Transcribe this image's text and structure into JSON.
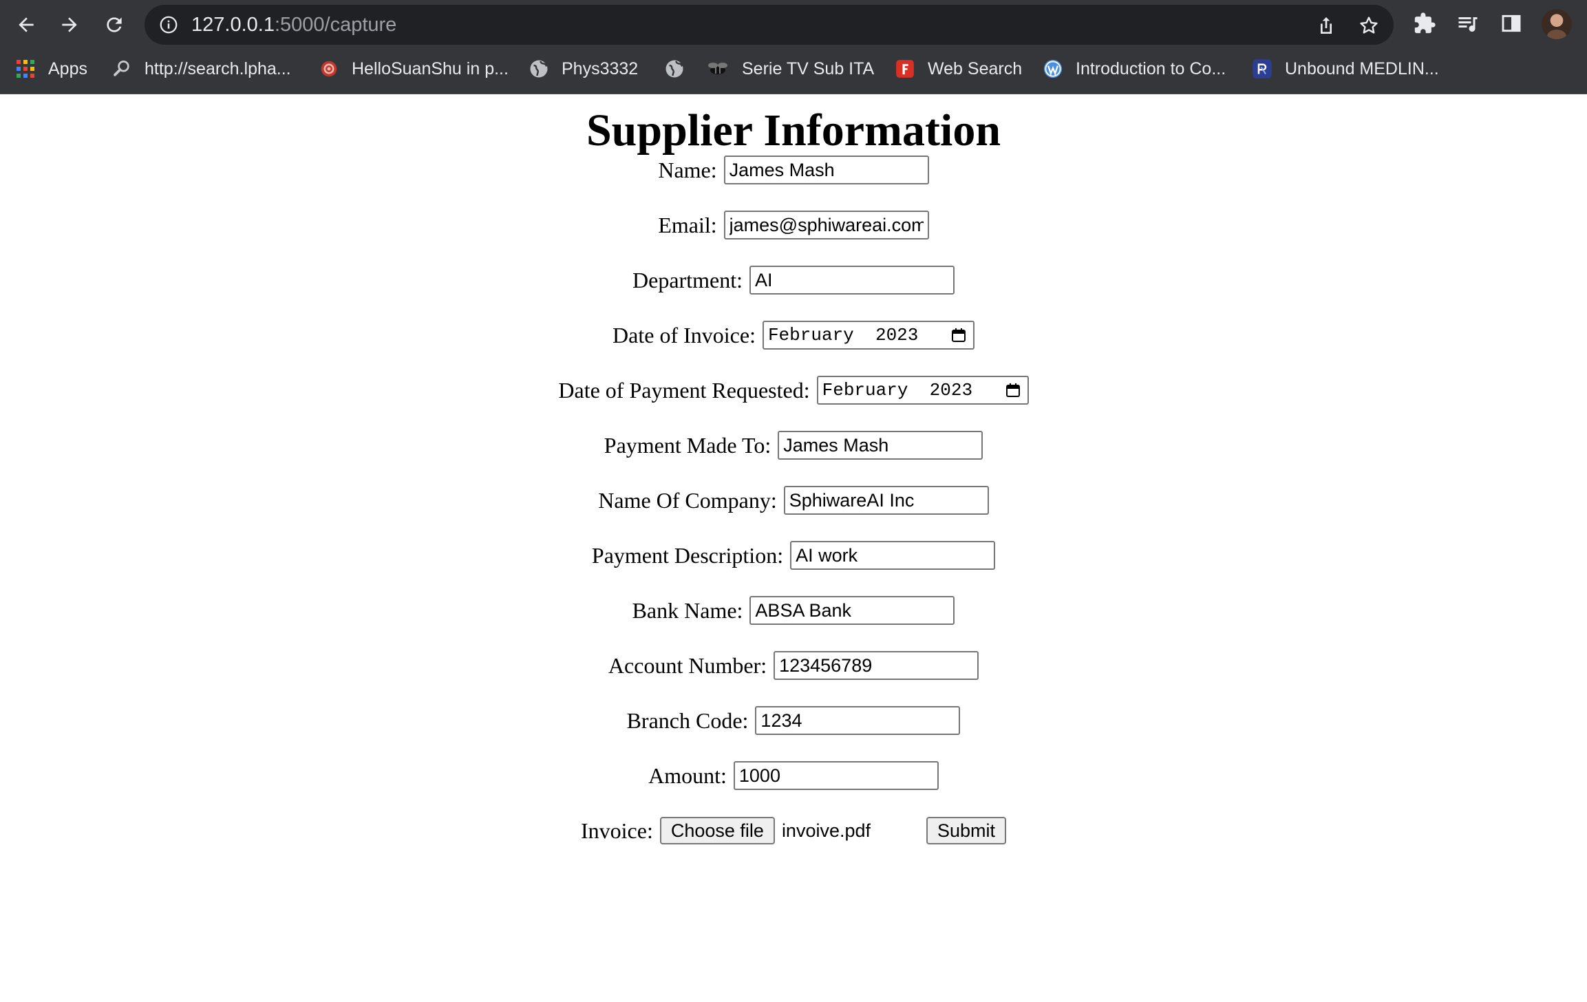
{
  "browser": {
    "url_host": "127.0.0.1",
    "url_path": ":5000/capture",
    "bookmarks": [
      {
        "label": "Apps",
        "icon": "apps-grid-icon"
      },
      {
        "label": "http://search.lpha...",
        "icon": "search-icon"
      },
      {
        "label": "HelloSuanShu in p...",
        "icon": "suanshu-logo-icon"
      },
      {
        "label": "Phys3332",
        "icon": "globe-icon"
      },
      {
        "label": "",
        "icon": "globe-icon"
      },
      {
        "label": "Serie TV Sub ITA",
        "icon": "bee-icon"
      },
      {
        "label": "Web Search",
        "icon": "f-logo-icon"
      },
      {
        "label": "Introduction to Co...",
        "icon": "wordpress-icon"
      },
      {
        "label": "Unbound MEDLIN...",
        "icon": "pubmed-icon"
      }
    ]
  },
  "form": {
    "title": "Supplier Information",
    "name": {
      "label": "Name:",
      "value": "James Mash"
    },
    "email": {
      "label": "Email:",
      "value": "james@sphiwareai.com"
    },
    "department": {
      "label": "Department:",
      "value": "AI"
    },
    "invoice_date": {
      "label": "Date of Invoice:",
      "value": "February  2023"
    },
    "payment_date": {
      "label": "Date of Payment Requested:",
      "value": "February  2023"
    },
    "payment_to": {
      "label": "Payment Made To:",
      "value": "James Mash"
    },
    "company": {
      "label": "Name Of Company:",
      "value": "SphiwareAI Inc"
    },
    "description": {
      "label": "Payment Description:",
      "value": "AI work"
    },
    "bank": {
      "label": "Bank Name:",
      "value": "ABSA Bank"
    },
    "account": {
      "label": "Account Number:",
      "value": "123456789"
    },
    "branch": {
      "label": "Branch Code:",
      "value": "1234"
    },
    "amount": {
      "label": "Amount:",
      "value": "1000"
    },
    "invoice_file": {
      "label": "Invoice:",
      "button": "Choose file",
      "filename": "invoive.pdf"
    },
    "submit": "Submit"
  }
}
